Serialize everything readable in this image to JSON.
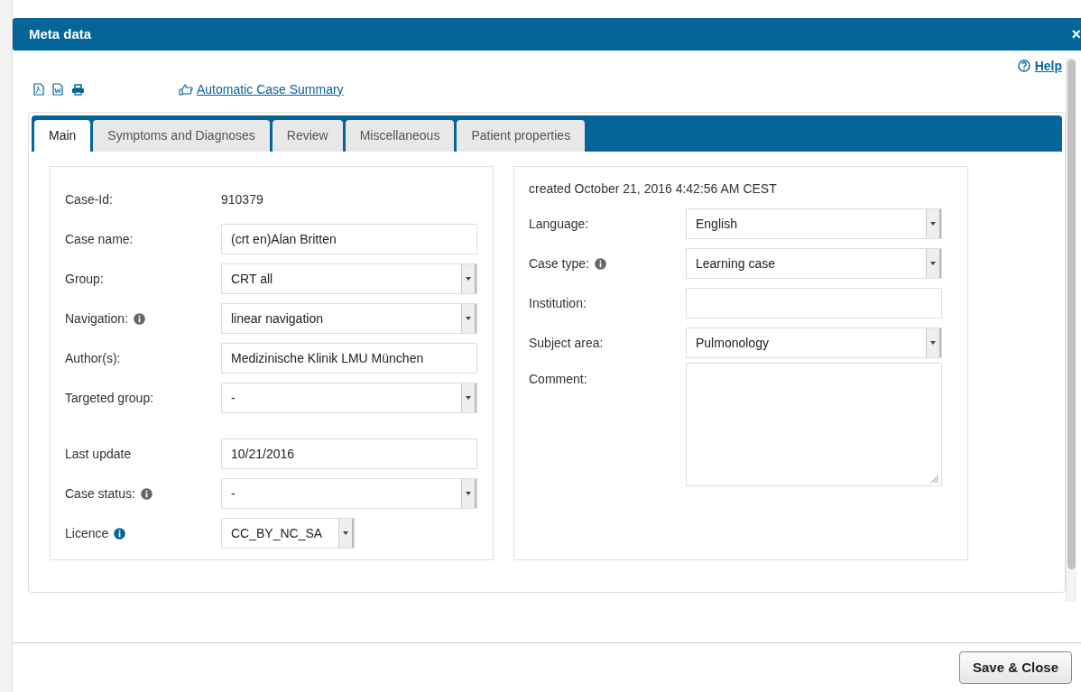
{
  "dialog": {
    "title": "Meta data",
    "close": "×"
  },
  "help_link": "Help",
  "toolbar": {
    "summary_link": "Automatic Case Summary"
  },
  "tabs": [
    {
      "label": "Main",
      "selected": true
    },
    {
      "label": "Symptoms and Diagnoses",
      "selected": false
    },
    {
      "label": "Review",
      "selected": false
    },
    {
      "label": "Miscellaneous",
      "selected": false
    },
    {
      "label": "Patient properties",
      "selected": false
    }
  ],
  "left_fields": [
    {
      "label": "Case-Id:",
      "kind": "static",
      "value": "910379"
    },
    {
      "label": "Case name:",
      "kind": "input",
      "value": "(crt en)Alan Britten"
    },
    {
      "label": "Group:",
      "kind": "select",
      "value": "CRT all"
    },
    {
      "label": "Navigation:",
      "kind": "select",
      "value": "linear navigation",
      "info": true,
      "highlighted": false
    },
    {
      "label": "Author(s):",
      "kind": "input",
      "value": "Medizinische Klinik LMU München"
    },
    {
      "label": "Targeted group:",
      "kind": "select",
      "value": "-"
    },
    {
      "label": "Last update",
      "kind": "input",
      "value": "10/21/2016",
      "gap_before": true
    },
    {
      "label": "Case status:",
      "kind": "select",
      "value": "-",
      "info": true,
      "highlighted": false
    },
    {
      "label": "Licence",
      "kind": "select",
      "value": "CC_BY_NC_SA",
      "info": true,
      "highlighted": true,
      "compact": true
    }
  ],
  "right_panel": {
    "created": "created October 21, 2016 4:42:56 AM CEST",
    "fields": [
      {
        "label": "Language:",
        "kind": "select",
        "value": "English"
      },
      {
        "label": "Case type:",
        "kind": "select",
        "value": "Learning case",
        "info": true,
        "highlighted": false
      },
      {
        "label": "Institution:",
        "kind": "input"
      },
      {
        "label": "Subject area:",
        "kind": "select",
        "value": "Pulmonology"
      },
      {
        "label": "Comment:",
        "kind": "textarea"
      }
    ]
  },
  "buttons": [
    "Save & Close"
  ]
}
